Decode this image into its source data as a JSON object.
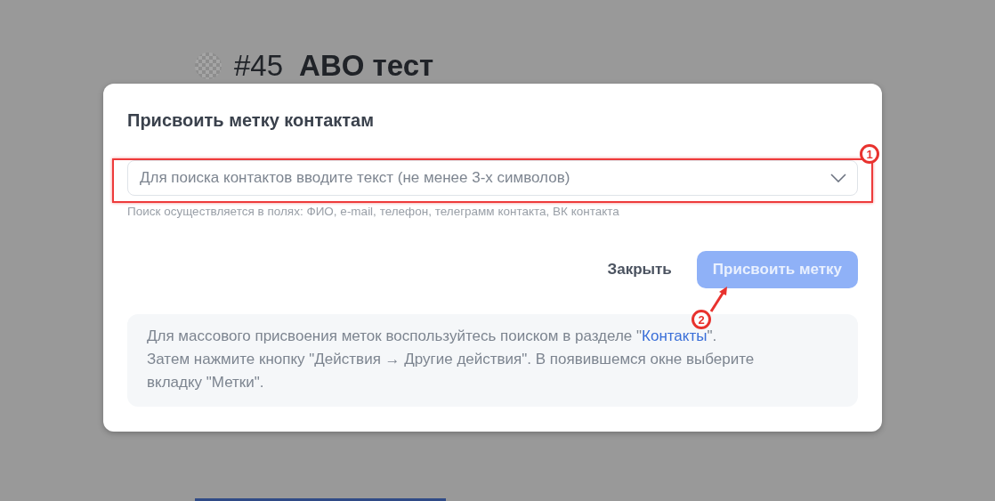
{
  "background_page": {
    "number": "#45",
    "title": "ABO тест"
  },
  "dialog": {
    "title": "Присвоить метку контактам",
    "search": {
      "placeholder": "Для поиска контактов вводите текст (не менее 3-х символов)",
      "hint": "Поиск осуществляется в полях: ФИО, e-mail, телефон, телеграмм контакта, ВК контакта"
    },
    "buttons": [
      {
        "label": "Закрыть",
        "kind": "text",
        "disabled": false
      },
      {
        "label": "Присвоить метку",
        "kind": "primary",
        "disabled": true
      }
    ],
    "note": {
      "text_before": "Для массового присвоения меток воспользуйтесь поиском в разделе \"",
      "link": "Контакты",
      "text_after": "\".\nЗатем нажмите кнопку \"Действия → Другие действия\". В появившемся окне выберите вкладку \"Метки\"."
    }
  },
  "annotations": [
    {
      "label": "1"
    },
    {
      "label": "2"
    }
  ]
}
